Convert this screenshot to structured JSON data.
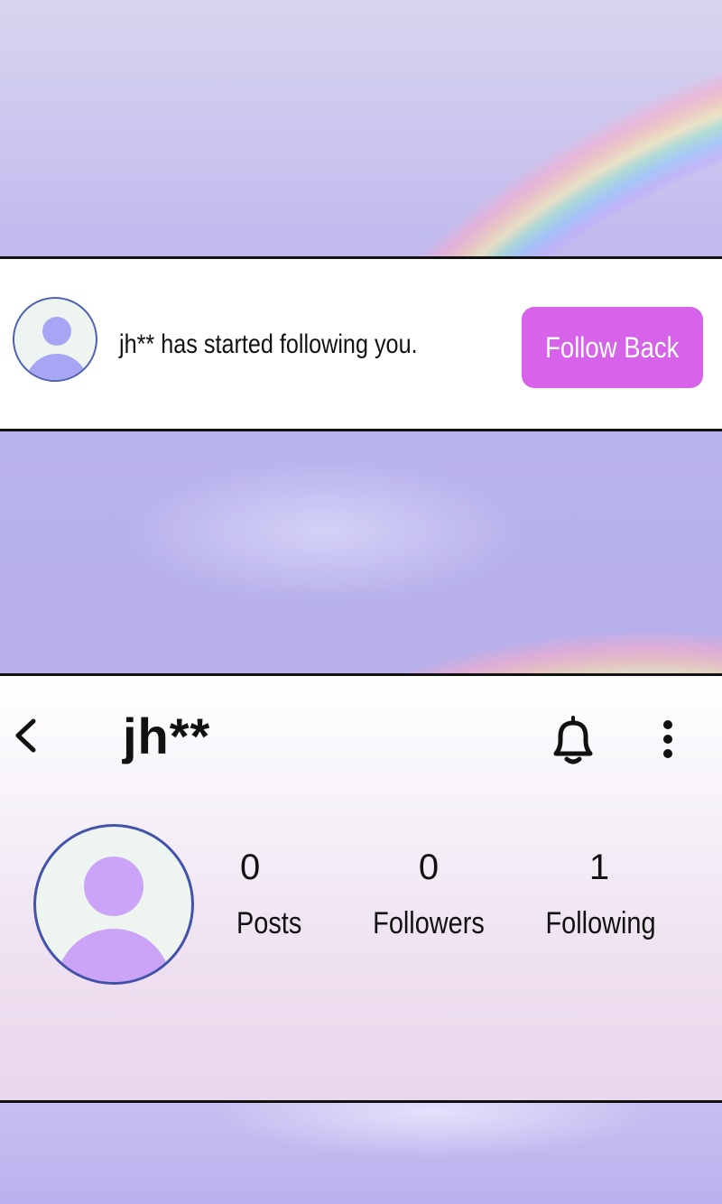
{
  "notification": {
    "message": "jh** has started following you.",
    "follow_back_label": "Follow Back",
    "follow_back_color": "#d763ea",
    "avatar_icon": "user-avatar-icon"
  },
  "profile": {
    "username": "jh**",
    "back_icon": "chevron-left-icon",
    "bell_icon": "bell-icon",
    "more_icon": "more-vertical-icon",
    "avatar_icon": "user-avatar-icon",
    "stats": [
      {
        "value": "0",
        "label": "Posts"
      },
      {
        "value": "0",
        "label": "Followers"
      },
      {
        "value": "1",
        "label": "Following"
      }
    ]
  }
}
